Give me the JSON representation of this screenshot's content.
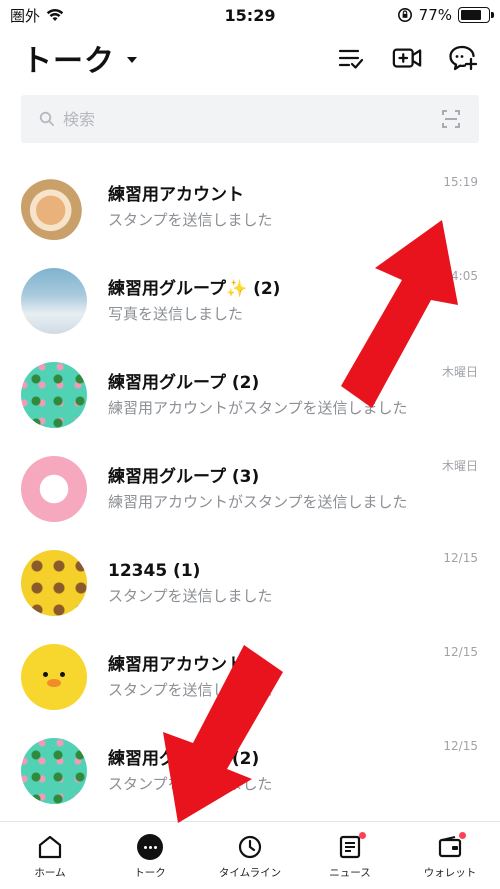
{
  "status_bar": {
    "carrier": "圏外",
    "time": "15:29",
    "battery_percent": "77%",
    "battery_level": 0.77
  },
  "header": {
    "title": "トーク"
  },
  "search": {
    "placeholder": "検索"
  },
  "chats": [
    {
      "name": "練習用アカウント",
      "preview": "スタンプを送信しました",
      "time": "15:19"
    },
    {
      "name": "練習用グループ✨  (2)",
      "preview": "写真を送信しました",
      "time": "14:05"
    },
    {
      "name": "練習用グループ  (2)",
      "preview": "練習用アカウントがスタンプを送信しました",
      "time": "木曜日"
    },
    {
      "name": "練習用グループ  (3)",
      "preview": "練習用アカウントがスタンプを送信しました",
      "time": "木曜日"
    },
    {
      "name": "12345  (1)",
      "preview": "スタンプを送信しました",
      "time": "12/15"
    },
    {
      "name": "練習用アカウント",
      "preview": "スタンプを送信しました",
      "time": "12/15"
    },
    {
      "name": "練習用グループ  (2)",
      "preview": "スタンプを送信しました",
      "time": "12/15"
    }
  ],
  "bottom_nav": {
    "items": [
      {
        "label": "ホーム",
        "icon": "home-icon"
      },
      {
        "label": "トーク",
        "icon": "talk-icon"
      },
      {
        "label": "タイムライン",
        "icon": "clock-icon"
      },
      {
        "label": "ニュース",
        "icon": "news-icon"
      },
      {
        "label": "ウォレット",
        "icon": "wallet-icon"
      }
    ]
  },
  "colors": {
    "annotation_arrow": "#e8131c",
    "notification_dot": "#ff4057"
  }
}
